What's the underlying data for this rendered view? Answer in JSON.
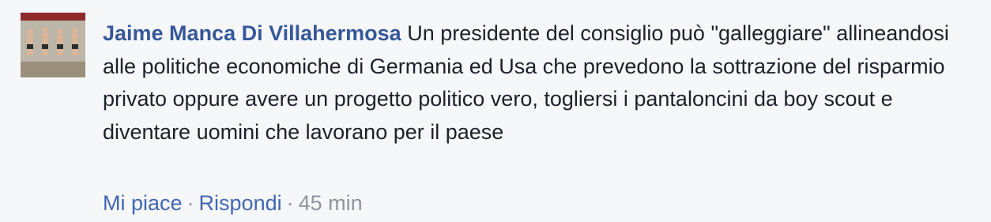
{
  "comment": {
    "author": "Jaime Manca Di Villahermosa",
    "text": "Un presidente del consiglio può \"galleggiare\" allineandosi alle politiche economiche di Germania ed Usa che prevedono la sottrazione del risparmio privato oppure avere un progetto politico vero, togliersi i pantaloncini da boy scout e diventare uomini che lavorano per il paese",
    "actions": {
      "like_label": "Mi piace",
      "reply_label": "Rispondi",
      "separator": "·",
      "timestamp": "45 min"
    }
  },
  "colors": {
    "background": "#f6f7f9",
    "author": "#365899",
    "link": "#4267b2",
    "text": "#1d2129",
    "muted": "#90949c"
  },
  "icons": {
    "avatar": "profile-photo"
  }
}
